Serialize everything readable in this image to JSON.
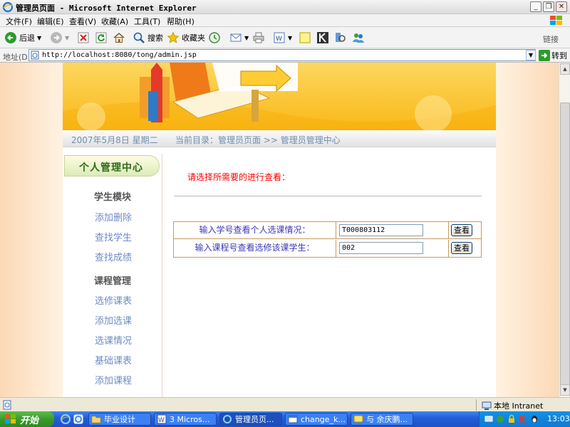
{
  "window": {
    "title": "管理员页面 - Microsoft Internet Explorer"
  },
  "menu": [
    "文件(F)",
    "编辑(E)",
    "查看(V)",
    "收藏(A)",
    "工具(T)",
    "帮助(H)"
  ],
  "toolbar": {
    "back": "后退",
    "search": "搜索",
    "favorites": "收藏夹",
    "links": "链接"
  },
  "address": {
    "label": "地址(D)",
    "url": "http://localhost:8080/tong/admin.jsp",
    "go": "转到"
  },
  "page": {
    "date": "2007年5月8日  星期二",
    "breadcrumb": "当前目录：管理员页面 >> 管理员管理中心",
    "sidebar": {
      "title": "个人管理中心",
      "section1": "学生模块",
      "section1_items": [
        "添加删除",
        "查找学生",
        "查找成绩"
      ],
      "section2": "课程管理",
      "section2_items": [
        "选修课表",
        "添加选课",
        "选课情况",
        "基础课表",
        "添加课程"
      ]
    },
    "prompt": "请选择所需要的进行查看：",
    "query_rows": [
      {
        "label": "输入学号查看个人选课情况：",
        "value": "T000803112",
        "button": "查看"
      },
      {
        "label": "输入课程号查看选修该课学生：",
        "value": "002",
        "button": "查看"
      }
    ]
  },
  "statusbar": {
    "zone": "本地 Intranet"
  },
  "taskbar": {
    "start": "开始",
    "tasks": [
      "毕业设计",
      "3 Micros...",
      "管理员页...",
      "change_k...",
      "与 余庆鹏..."
    ],
    "clock": "13:03"
  }
}
